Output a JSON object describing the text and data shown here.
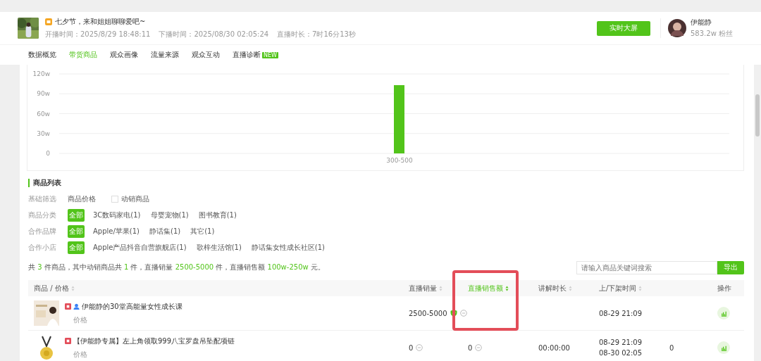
{
  "header": {
    "title": "七夕节，来和姐姐聊聊爱吧~",
    "meta": [
      {
        "label": "开播时间：",
        "value": "2025/8/29 18:48:11"
      },
      {
        "label": "下播时间：",
        "value": "2025/08/30 02:05:24"
      },
      {
        "label": "直播时长：",
        "value": "7时16分13秒"
      }
    ],
    "button": "实时大屏",
    "anchor": {
      "name": "伊能静",
      "fans": "583.2w 粉丝"
    }
  },
  "tabs": [
    {
      "label": "数据概览",
      "selected": false
    },
    {
      "label": "带货商品",
      "selected": true
    },
    {
      "label": "观众画像",
      "selected": false
    },
    {
      "label": "流量来源",
      "selected": false
    },
    {
      "label": "观众互动",
      "selected": false
    },
    {
      "label": "直播诊断",
      "selected": false,
      "badge": "NEW"
    }
  ],
  "chart_data": {
    "type": "bar",
    "grid": true,
    "categories": [
      "300-500"
    ],
    "series": [
      {
        "color": "#52c41a",
        "values": [
          103
        ]
      }
    ],
    "ylim": [
      0,
      120
    ],
    "yticks": [
      {
        "value": 0,
        "label": "0"
      },
      {
        "value": 30,
        "label": "30w"
      },
      {
        "value": 60,
        "label": "60w"
      },
      {
        "value": 90,
        "label": "90w"
      },
      {
        "value": 120,
        "label": "120w"
      }
    ]
  },
  "product_list": {
    "title": "商品列表",
    "basic_filter": {
      "label": "基础筛选",
      "price": "商品价格",
      "active_only": {
        "label": "动销商品",
        "checked": false
      }
    },
    "filters": [
      {
        "label": "商品分类",
        "options": [
          {
            "label": "全部",
            "selected": true
          },
          {
            "label": "3C数码家电(1)",
            "selected": false
          },
          {
            "label": "母婴宠物(1)",
            "selected": false
          },
          {
            "label": "图书教育(1)",
            "selected": false
          }
        ]
      },
      {
        "label": "合作品牌",
        "options": [
          {
            "label": "全部",
            "selected": true
          },
          {
            "label": "Apple/苹果(1)",
            "selected": false
          },
          {
            "label": "静话集(1)",
            "selected": false
          },
          {
            "label": "其它(1)",
            "selected": false
          }
        ]
      },
      {
        "label": "合作小店",
        "options": [
          {
            "label": "全部",
            "selected": true
          },
          {
            "label": "Apple产品抖音自营旗舰店(1)",
            "selected": false
          },
          {
            "label": "歌梓生活馆(1)",
            "selected": false
          },
          {
            "label": "静话集女性成长社区(1)",
            "selected": false
          }
        ]
      }
    ],
    "summary": [
      {
        "text": "共 ",
        "highlight": false
      },
      {
        "text": "3",
        "highlight": true
      },
      {
        "text": " 件商品，其中动销商品共 ",
        "highlight": false
      },
      {
        "text": "1",
        "highlight": true
      },
      {
        "text": " 件，直播销量 ",
        "highlight": false
      },
      {
        "text": "2500-5000",
        "highlight": true
      },
      {
        "text": " 件，直播销售额 ",
        "highlight": false
      },
      {
        "text": "100w-250w",
        "highlight": true
      },
      {
        "text": " 元。",
        "highlight": false
      }
    ],
    "search": {
      "placeholder": "请输入商品关键词搜索"
    },
    "export": "导出",
    "columns": [
      {
        "label": "商品 / 价格",
        "sorted": false
      },
      {
        "label": "直播销量",
        "sorted": false
      },
      {
        "label": "直播销售额",
        "sorted": true
      },
      {
        "label": "讲解时长",
        "sorted": false
      },
      {
        "label": "上/下架时间",
        "sorted": false
      },
      {
        "label": "操作"
      }
    ],
    "rows": [
      {
        "title": "伊能静的30堂高能量女性成长课",
        "price": "价格",
        "verified_author": true,
        "kind": "course",
        "sales": "2500-5000",
        "sales_verified": true,
        "times": [
          "08-29 21:09"
        ]
      },
      {
        "title": "【伊能静专属】左上角领取999八宝罗盘吊坠配项链",
        "price": "价格",
        "verified_author": false,
        "kind": "pendant",
        "sales": "0",
        "sales_verified": false,
        "amount": "0",
        "duration": "00:00:00",
        "times": [
          "08-29 21:09",
          "08-30 02:05"
        ],
        "column_6": "0"
      }
    ]
  }
}
